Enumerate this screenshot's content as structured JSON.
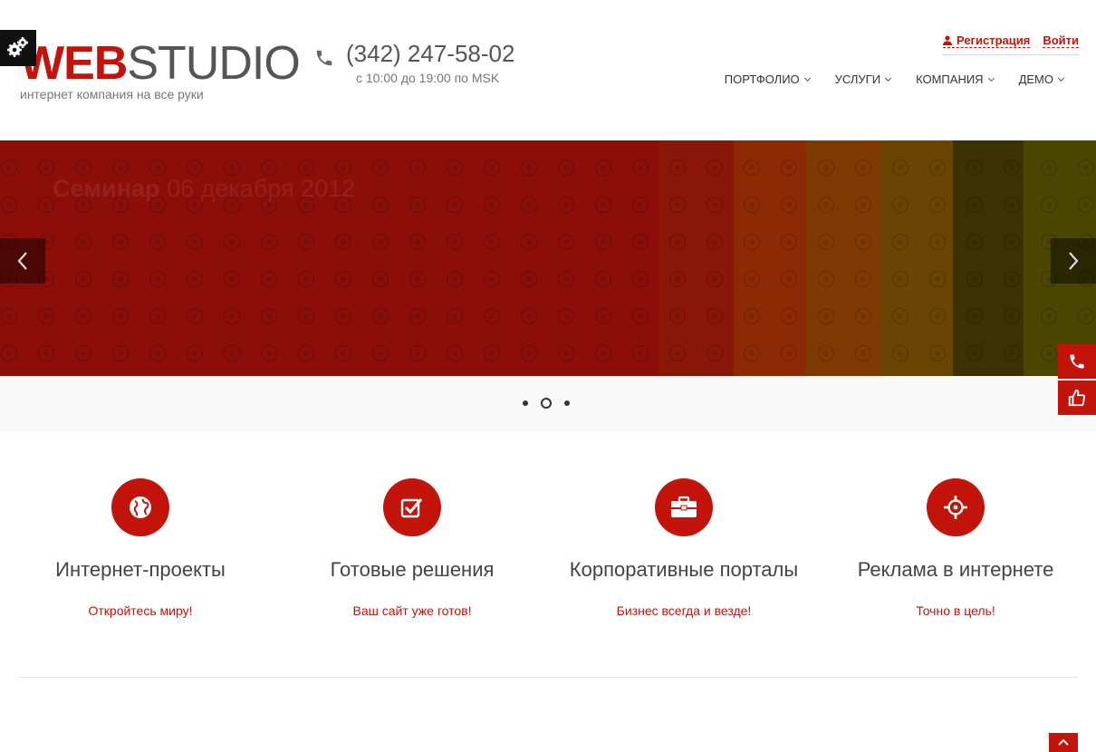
{
  "header": {
    "logo_bold": "WEB",
    "logo_light": "STUDIO",
    "tagline": "интернет компания на все руки",
    "phone": "(342) 247-58-02",
    "hours": "с 10:00 до 19:00 по MSK",
    "register_label": "Регистрация",
    "login_label": "Войти"
  },
  "nav": {
    "items": [
      {
        "label": "ПОРТФОЛИО"
      },
      {
        "label": "УСЛУГИ"
      },
      {
        "label": "КОМПАНИЯ"
      },
      {
        "label": "ДЕМО"
      }
    ]
  },
  "slider": {
    "title_bold": "Семинар",
    "title_rest": "06 декабря 2012",
    "active_slide": 2,
    "total_slides": 3
  },
  "features": [
    {
      "title": "Интернет-проекты",
      "subtitle": "Откройтесь миру!",
      "icon": "globe-icon"
    },
    {
      "title": "Готовые решения",
      "subtitle": "Ваш сайт уже готов!",
      "icon": "checkbox-icon"
    },
    {
      "title": "Корпоративные порталы",
      "subtitle": "Бизнес всегда и везде!",
      "icon": "briefcase-icon"
    },
    {
      "title": "Реклама в интернете",
      "subtitle": "Точно в цель!",
      "icon": "target-icon"
    }
  ],
  "colors": {
    "accent": "#c2140a",
    "slider_base": "#8b0f08",
    "text_dark": "#444444"
  }
}
